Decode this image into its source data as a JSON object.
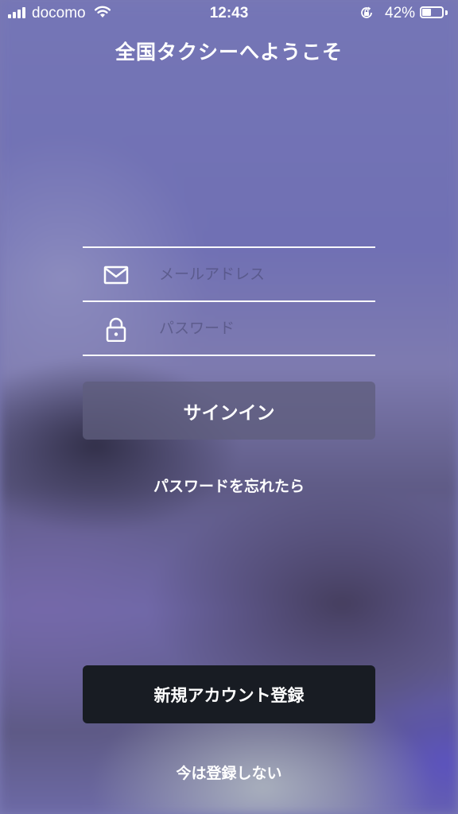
{
  "status_bar": {
    "carrier": "docomo",
    "time": "12:43",
    "battery_percent": "42%",
    "battery_level": 0.42,
    "icons": [
      "signal-icon",
      "wifi-icon",
      "rotation-lock-icon",
      "battery-icon"
    ]
  },
  "header": {
    "title": "全国タクシーへようこそ"
  },
  "login_form": {
    "email_placeholder": "メールアドレス",
    "email_value": "",
    "email_icon": "mail-icon",
    "password_placeholder": "パスワード",
    "password_value": "",
    "password_icon": "lock-icon"
  },
  "actions": {
    "signin_label": "サインイン",
    "forgot_password_label": "パスワードを忘れたら",
    "register_label": "新規アカウント登録",
    "skip_label": "今は登録しない"
  },
  "colors": {
    "background": "#7a79b4",
    "signin_button": "#5f5d7d",
    "register_button": "#181c23",
    "text": "#ffffff"
  }
}
